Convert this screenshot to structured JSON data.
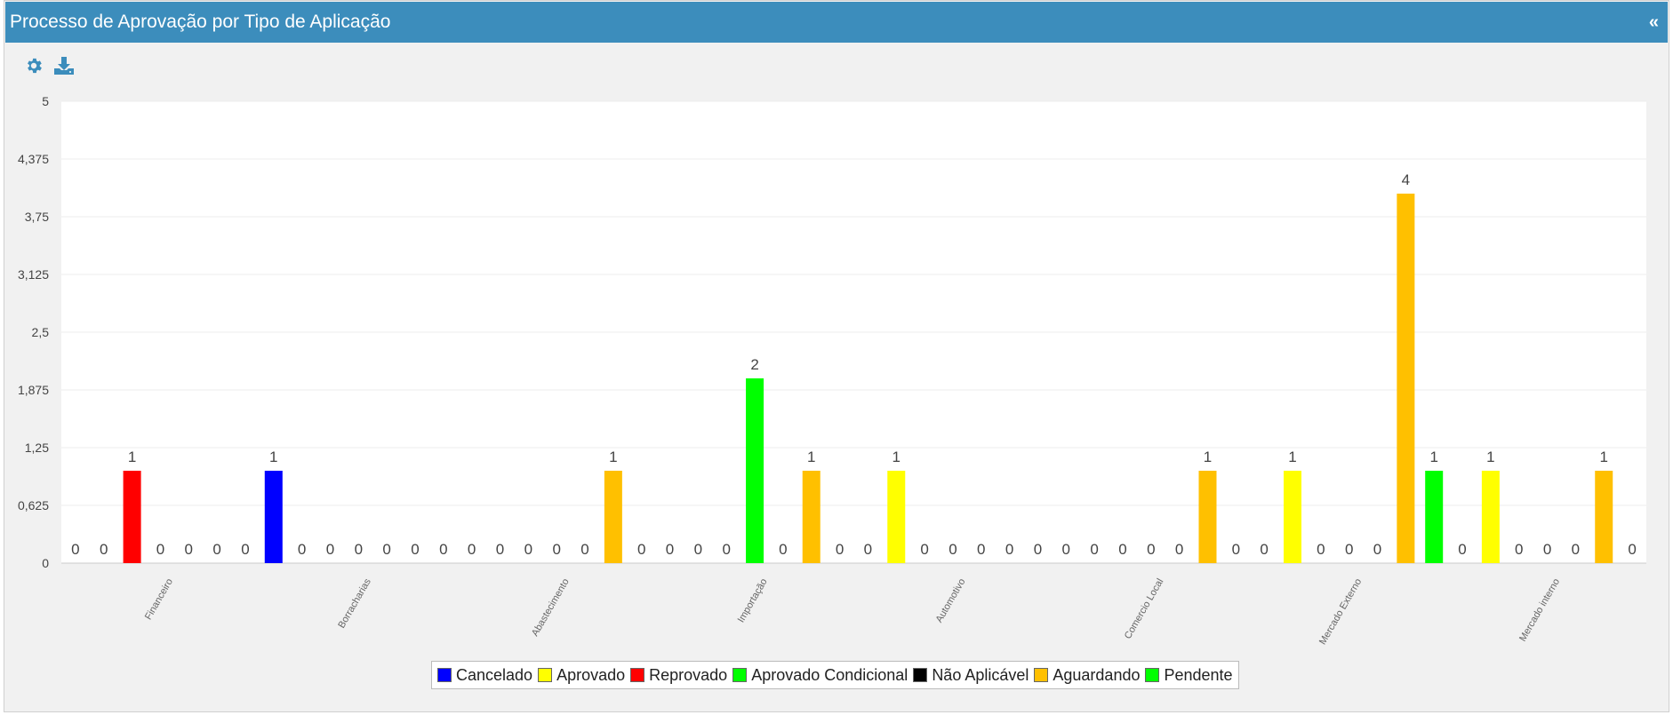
{
  "header": {
    "title": "Processo de Aprovação por Tipo de Aplicação",
    "collapse_label": "«"
  },
  "toolbar": {
    "settings_icon": "gear-icon",
    "download_icon": "download-icon",
    "icon_color": "#3c8dbc"
  },
  "legend": [
    {
      "name": "Cancelado",
      "color": "#0000ff"
    },
    {
      "name": "Aprovado",
      "color": "#ffff00"
    },
    {
      "name": "Reprovado",
      "color": "#ff0000"
    },
    {
      "name": "Aprovado Condicional",
      "color": "#00ff00"
    },
    {
      "name": "Não Aplicável",
      "color": "#000000"
    },
    {
      "name": "Aguardando",
      "color": "#ffc000"
    },
    {
      "name": "Pendente",
      "color": "#00ff00"
    }
  ],
  "chart_data": {
    "type": "bar",
    "categories": [
      "Financeiro",
      "Borracharias",
      "Abastecimento",
      "Importação",
      "Automotivo",
      "Comercio Local",
      "Mercado Externo",
      "Mercado interno"
    ],
    "series": [
      {
        "name": "Cancelado",
        "color": "#0000ff",
        "values": [
          0,
          1,
          0,
          0,
          0,
          0,
          0,
          0
        ]
      },
      {
        "name": "Aprovado",
        "color": "#ffff00",
        "values": [
          0,
          0,
          0,
          0,
          1,
          0,
          1,
          1
        ]
      },
      {
        "name": "Reprovado",
        "color": "#ff0000",
        "values": [
          1,
          0,
          0,
          0,
          0,
          0,
          0,
          0
        ]
      },
      {
        "name": "Aprovado Condicional",
        "color": "#00ff00",
        "values": [
          0,
          0,
          0,
          2,
          0,
          0,
          0,
          0
        ]
      },
      {
        "name": "Não Aplicável",
        "color": "#000000",
        "values": [
          0,
          0,
          0,
          0,
          0,
          0,
          0,
          0
        ]
      },
      {
        "name": "Aguardando",
        "color": "#ffc000",
        "values": [
          0,
          0,
          1,
          1,
          0,
          1,
          4,
          1
        ]
      },
      {
        "name": "Pendente",
        "color": "#00ff00",
        "values": [
          0,
          0,
          0,
          0,
          0,
          0,
          1,
          0
        ]
      }
    ],
    "yticks": [
      "0",
      "0,625",
      "1,25",
      "1,875",
      "2,5",
      "3,125",
      "3,75",
      "4,375",
      "5"
    ],
    "ylim": [
      0,
      5
    ],
    "grid": true,
    "legend_position": "bottom"
  }
}
